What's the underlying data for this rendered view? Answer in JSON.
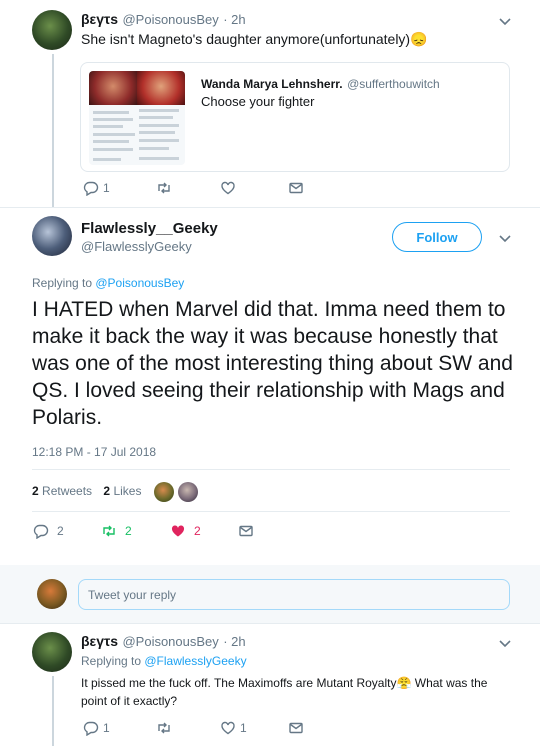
{
  "colors": {
    "accent": "#1da1f2",
    "muted": "#657786",
    "like": "#e0245e",
    "retweet": "#17bf63"
  },
  "tweet1": {
    "name": "βεγτѕ",
    "handle": "@PoisonousBey",
    "time": "· 2h",
    "text": "She isn't Magneto's daughter anymore(unfortunately)😞",
    "quote": {
      "name": "Wanda Marya Lehnsherr.",
      "handle": "@sufferthouwitch",
      "text": "Choose your fighter"
    },
    "actions": {
      "reply_count": "1",
      "retweet_count": "",
      "like_count": ""
    }
  },
  "tweet2": {
    "name": "Flawlessly__Geeky",
    "handle": "@FlawlesslyGeeky",
    "follow_label": "Follow",
    "replying_prefix": "Replying to ",
    "replying_handle": "@PoisonousBey",
    "text": "I HATED when Marvel did that. Imma need them to make it back the way it was because honestly that was one of the most interesting thing about SW and QS. I loved seeing their relationship with Mags and Polaris.",
    "timestamp": "12:18 PM - 17 Jul 2018",
    "stats": {
      "retweets_count": "2",
      "retweets_label": "Retweets",
      "likes_count": "2",
      "likes_label": "Likes"
    },
    "actions": {
      "reply_count": "2",
      "retweet_count": "2",
      "like_count": "2"
    }
  },
  "reply_box": {
    "placeholder": "Tweet your reply"
  },
  "tweet3": {
    "name": "βεγτѕ",
    "handle": "@PoisonousBey",
    "time": "· 2h",
    "replying_prefix": "Replying to ",
    "replying_handle": "@FlawlesslyGeeky",
    "text": "It pissed me the fuck off. The Maximoffs are Mutant Royalty😤 What was the point of it exactly?",
    "actions": {
      "reply_count": "1",
      "retweet_count": "",
      "like_count": "1"
    }
  }
}
